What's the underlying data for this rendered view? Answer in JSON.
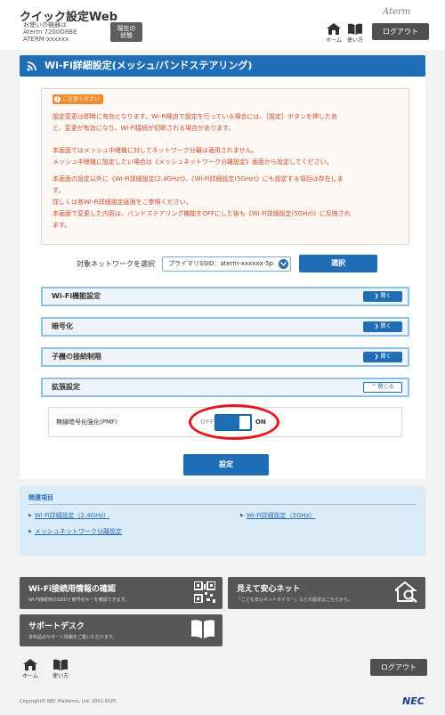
{
  "header": {
    "app_title": "クイック設定Web",
    "device_line1": "お使いの機器は",
    "device_line2": "Aterm 7200D8BE",
    "device_line3": "ATERM-xxxxxx",
    "status_button_line1": "現在の",
    "status_button_line2": "状態",
    "brand": "Aterm",
    "home_label": "ホーム",
    "usage_label": "使い方",
    "logout_label": "ログアウト"
  },
  "page_title": "Wi-Fi詳細設定(メッシュ/バンドステアリング)",
  "notice": {
    "badge": "ご注意ください",
    "para1_line1": "設定変更は即時に有効となります。Wi-Fi経由で設定を行っている場合には、［設定］ボタンを押したあ",
    "para1_line2": "と、変更が有効になり、Wi-Fi接続が切断される場合があります。",
    "para2_line1": "本画面ではメッシュ中継機に対してネットワーク分離は適用されません。",
    "para2_line2": "メッシュ中継機に設定したい場合は《メッシュネットワーク分離設定》画面から設定してください。",
    "para3_line1": "本画面の設定以外に《Wi-Fi詳細設定(2.4GHz)》、《Wi-Fi詳細設定(5GHz)》にも設定する項目は存在しま",
    "para3_line2": "す。",
    "para3_line3": "詳しくは各Wi-Fi詳細設定画面をご参照ください。",
    "para3_line4": "本画面で変更した内容は、バンドステアリング機能をOFFにした後も《Wi-Fi詳細設定(5GHz)》に反映され",
    "para3_line5": "ます。"
  },
  "network_select": {
    "label": "対象ネットワークを選択",
    "value": "プライマリSSID：aterm-xxxxxx-5p",
    "button": "選択"
  },
  "sections": {
    "wifi_function": {
      "label": "Wi-Fi機能設定",
      "toggle": "開く"
    },
    "encryption": {
      "label": "暗号化",
      "toggle": "開く"
    },
    "client_limit": {
      "label": "子機の接続制限",
      "toggle": "開く"
    },
    "extended": {
      "label": "拡張設定",
      "toggle": "閉じる"
    }
  },
  "pmf": {
    "label": "無線暗号化強化(PMF)",
    "off_label": "OFF",
    "on_label": "ON",
    "state": "ON"
  },
  "setting_button": "設定",
  "related": {
    "title": "関連項目",
    "link_24": "Wi-Fi詳細設定（2.4GHz）",
    "link_5": "Wi-Fi詳細設定（5GHz）",
    "link_mesh": "メッシュネットワーク分離設定"
  },
  "promos": {
    "wifi_info": {
      "title": "Wi-Fi接続用情報の確認",
      "desc": "Wi-Fi接続用のSSIDと暗号化キーを確認できます。"
    },
    "mieru": {
      "title": "見えて安心ネット",
      "desc": "「こども安心ネットタイマー」などの設定はこちらから。"
    },
    "support": {
      "title": "サポートデスク",
      "desc": "本商品のサポート情報をご覧いただけます。"
    }
  },
  "footer": {
    "home_label": "ホーム",
    "usage_label": "使い方",
    "logout_label": "ログアウト",
    "copyright": "Copyright© NEC Platforms, Ltd. 2001-2025",
    "nec": "NEC"
  },
  "colors": {
    "primary": "#1f6eb6",
    "notice_text": "#c94a2a",
    "highlight": "#e8141b"
  }
}
